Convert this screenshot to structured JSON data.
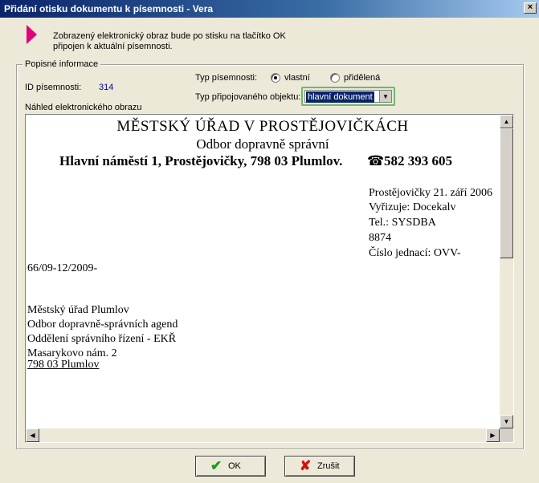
{
  "window": {
    "title": "Přidání otisku dokumentu k písemnosti - Vera",
    "close_glyph": "×"
  },
  "info": {
    "text_line1": "Zobrazený elektronický obraz bude po stisku na tlačítko OK",
    "text_line2": "připojen k aktuální písemnosti."
  },
  "group": {
    "legend": "Popisné informace",
    "id_label": "ID písemnosti:",
    "id_value": "314",
    "preview_label": "Náhled elektronického obrazu",
    "type_label": "Typ písemnosti:",
    "type_options": [
      {
        "label": "vlastní",
        "selected": true
      },
      {
        "label": "přidělená",
        "selected": false
      }
    ],
    "object_label": "Typ připojovaného objektu:",
    "object_value": "hlavní dokument"
  },
  "document": {
    "org_name": "MĚSTSKÝ  ÚŘAD  V PROSTĚJOVIČKÁCH",
    "department": "Odbor dopravně  správní",
    "address_line": "Hlavní náměstí 1, Prostějovičky, 798 03  Plumlov.",
    "phone_icon": "☎",
    "phone": "582 393 605",
    "right_block": [
      "Prostějovičky 21. září 2006",
      "Vyřizuje: Docekalv",
      "Tel.: SYSDBA",
      "8874",
      "Číslo jednací: OVV-"
    ],
    "ref_continuation": "66/09-12/2009-",
    "recipient": [
      "Městský úřad Plumlov",
      "Odbor dopravně-správních agend",
      "Oddělení správního řízení - EKŘ",
      "Masarykovo nám. 2"
    ],
    "recipient_city": "798 03  Plumlov"
  },
  "buttons": {
    "ok_label": "OK",
    "cancel_label": "Zrušit"
  },
  "colors": {
    "accent_arrow": "#e0007a",
    "ok_icon": "#1a9a1a",
    "cancel_icon": "#d01010",
    "id_value": "#0000a0"
  }
}
